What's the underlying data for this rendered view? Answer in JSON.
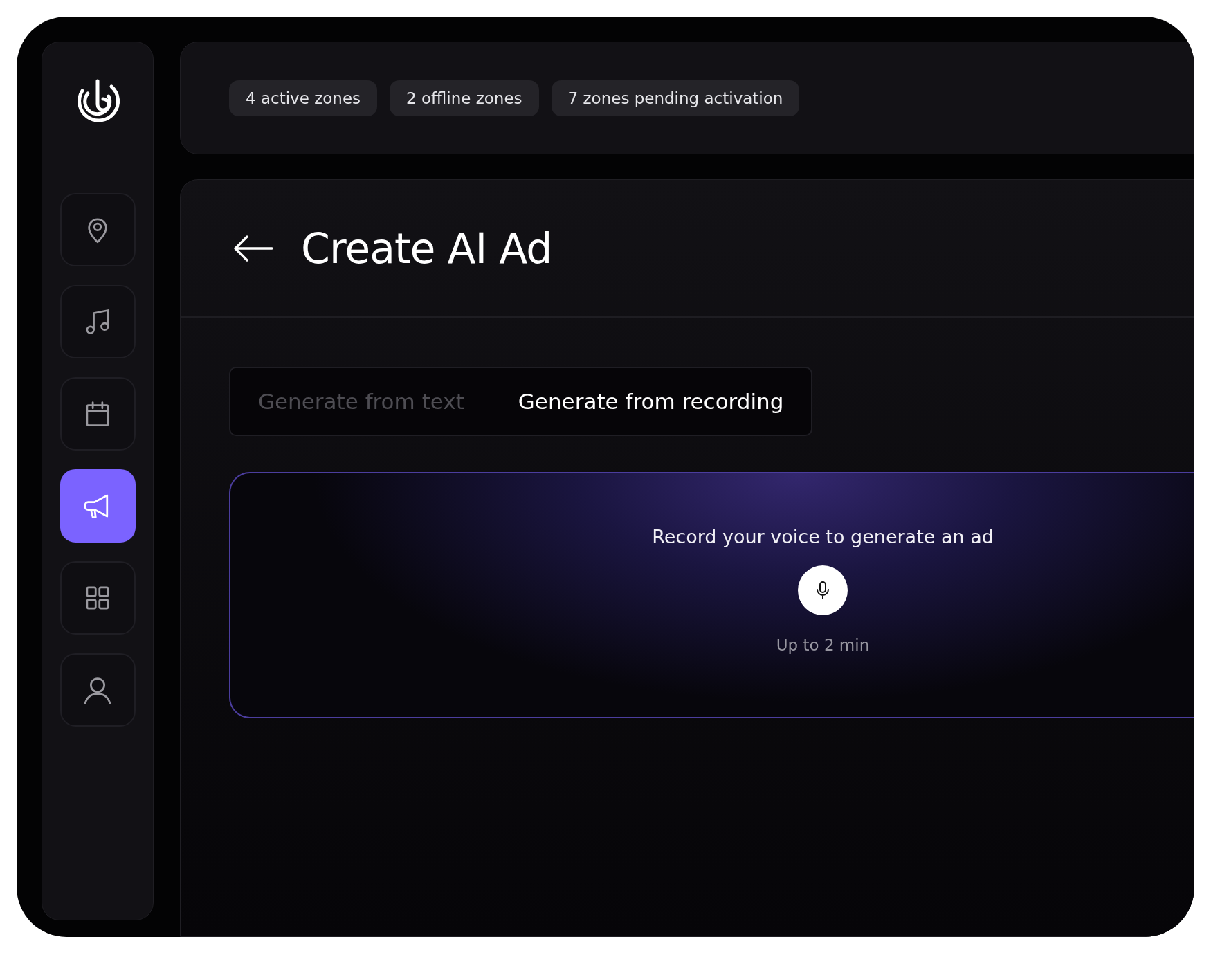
{
  "sidebar": {
    "items": [
      {
        "kind": "pin",
        "selected": false
      },
      {
        "kind": "music",
        "selected": false
      },
      {
        "kind": "calendar",
        "selected": false
      },
      {
        "kind": "megaphone",
        "selected": true
      },
      {
        "kind": "grid",
        "selected": false
      },
      {
        "kind": "user",
        "selected": false
      }
    ]
  },
  "status_chips": [
    "4 active zones",
    "2 offline zones",
    "7 zones pending activation"
  ],
  "header": {
    "title": "Create AI Ad"
  },
  "tabs": [
    {
      "label": "Generate from text",
      "selected": false
    },
    {
      "label": "Generate from recording",
      "selected": true
    }
  ],
  "record_panel": {
    "prompt": "Record your voice to generate an ad",
    "hint": "Up to 2 min"
  }
}
